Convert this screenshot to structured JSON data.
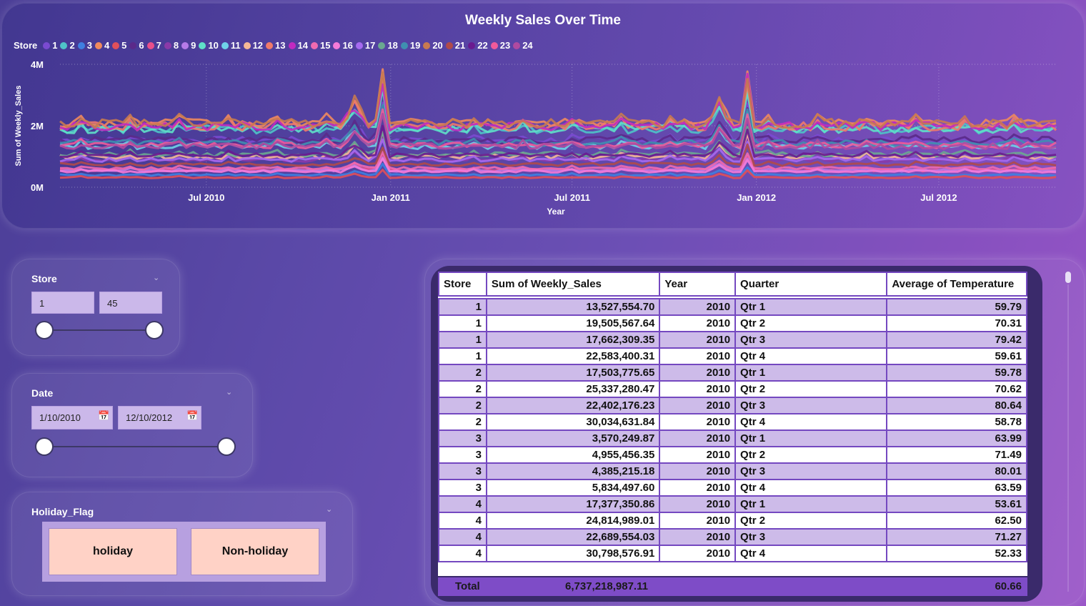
{
  "chart": {
    "title": "Weekly Sales Over Time",
    "legend_title": "Store",
    "legend": [
      {
        "label": "1",
        "color": "#7a4ad1"
      },
      {
        "label": "2",
        "color": "#4fc3c8"
      },
      {
        "label": "3",
        "color": "#3f7fe0"
      },
      {
        "label": "4",
        "color": "#f08a5d"
      },
      {
        "label": "5",
        "color": "#e0505a"
      },
      {
        "label": "6",
        "color": "#5a2a8a"
      },
      {
        "label": "7",
        "color": "#e84f8a"
      },
      {
        "label": "8",
        "color": "#8a3aa8"
      },
      {
        "label": "9",
        "color": "#b57ae8"
      },
      {
        "label": "10",
        "color": "#5fe0c8"
      },
      {
        "label": "11",
        "color": "#6fd3e8"
      },
      {
        "label": "12",
        "color": "#f5b896"
      },
      {
        "label": "13",
        "color": "#f07a6a"
      },
      {
        "label": "14",
        "color": "#c02ac0"
      },
      {
        "label": "15",
        "color": "#f06ab0"
      },
      {
        "label": "16",
        "color": "#f57ad8"
      },
      {
        "label": "17",
        "color": "#a66af0"
      },
      {
        "label": "18",
        "color": "#6aa890"
      },
      {
        "label": "19",
        "color": "#3f8fb0"
      },
      {
        "label": "20",
        "color": "#c87a50"
      },
      {
        "label": "21",
        "color": "#b04a4a"
      },
      {
        "label": "22",
        "color": "#6a1a90"
      },
      {
        "label": "23",
        "color": "#f05a9a"
      },
      {
        "label": "24",
        "color": "#b04aa0"
      }
    ]
  },
  "slicers": {
    "store": {
      "title": "Store",
      "min": "1",
      "max": "45"
    },
    "date": {
      "title": "Date",
      "start": "1/10/2010",
      "end": "12/10/2012"
    },
    "holiday": {
      "title": "Holiday_Flag",
      "options": [
        "holiday",
        "Non-holiday"
      ]
    }
  },
  "table": {
    "headers": [
      "Store",
      "Sum of Weekly_Sales",
      "Year",
      "Quarter",
      "Average of Temperature"
    ],
    "rows": [
      [
        "1",
        "13,527,554.70",
        "2010",
        "Qtr 1",
        "59.79"
      ],
      [
        "1",
        "19,505,567.64",
        "2010",
        "Qtr 2",
        "70.31"
      ],
      [
        "1",
        "17,662,309.35",
        "2010",
        "Qtr 3",
        "79.42"
      ],
      [
        "1",
        "22,583,400.31",
        "2010",
        "Qtr 4",
        "59.61"
      ],
      [
        "2",
        "17,503,775.65",
        "2010",
        "Qtr 1",
        "59.78"
      ],
      [
        "2",
        "25,337,280.47",
        "2010",
        "Qtr 2",
        "70.62"
      ],
      [
        "2",
        "22,402,176.23",
        "2010",
        "Qtr 3",
        "80.64"
      ],
      [
        "2",
        "30,034,631.84",
        "2010",
        "Qtr 4",
        "58.78"
      ],
      [
        "3",
        "3,570,249.87",
        "2010",
        "Qtr 1",
        "63.99"
      ],
      [
        "3",
        "4,955,456.35",
        "2010",
        "Qtr 2",
        "71.49"
      ],
      [
        "3",
        "4,385,215.18",
        "2010",
        "Qtr 3",
        "80.01"
      ],
      [
        "3",
        "5,834,497.60",
        "2010",
        "Qtr 4",
        "63.59"
      ],
      [
        "4",
        "17,377,350.86",
        "2010",
        "Qtr 1",
        "53.61"
      ],
      [
        "4",
        "24,814,989.01",
        "2010",
        "Qtr 2",
        "62.50"
      ],
      [
        "4",
        "22,689,554.03",
        "2010",
        "Qtr 3",
        "71.27"
      ],
      [
        "4",
        "30,798,576.91",
        "2010",
        "Qtr 4",
        "52.33"
      ]
    ],
    "total": {
      "label": "Total",
      "sales": "6,737,218,987.11",
      "temp": "60.66"
    }
  },
  "chart_data": {
    "type": "line",
    "title": "Weekly Sales Over Time",
    "xlabel": "Year",
    "ylabel": "Sum of Weekly_Sales",
    "x_range": [
      "2010-02-05",
      "2012-10-26"
    ],
    "x_ticks": [
      "Jul 2010",
      "Jan 2011",
      "Jul 2011",
      "Jan 2012",
      "Jul 2012"
    ],
    "y_ticks": [
      "0M",
      "2M",
      "4M"
    ],
    "ylim": [
      0,
      4000000
    ],
    "legend_position": "top-left",
    "series": [
      {
        "name": "1",
        "base": 1550000
      },
      {
        "name": "2",
        "base": 1900000
      },
      {
        "name": "3",
        "base": 400000
      },
      {
        "name": "4",
        "base": 2100000
      },
      {
        "name": "5",
        "base": 320000
      },
      {
        "name": "6",
        "base": 1550000
      },
      {
        "name": "7",
        "base": 560000
      },
      {
        "name": "8",
        "base": 900000
      },
      {
        "name": "9",
        "base": 550000
      },
      {
        "name": "10",
        "base": 1900000
      },
      {
        "name": "11",
        "base": 1350000
      },
      {
        "name": "12",
        "base": 1000000
      },
      {
        "name": "13",
        "base": 2000000
      },
      {
        "name": "14",
        "base": 2000000
      },
      {
        "name": "15",
        "base": 620000
      },
      {
        "name": "16",
        "base": 520000
      },
      {
        "name": "17",
        "base": 900000
      },
      {
        "name": "18",
        "base": 1080000
      },
      {
        "name": "19",
        "base": 1450000
      },
      {
        "name": "20",
        "base": 2100000
      },
      {
        "name": "21",
        "base": 750000
      },
      {
        "name": "22",
        "base": 1050000
      },
      {
        "name": "23",
        "base": 1380000
      },
      {
        "name": "24",
        "base": 1350000
      }
    ],
    "peaks": [
      {
        "date": "Nov 2010",
        "multiplier": 1.35
      },
      {
        "date": "Dec 2010",
        "multiplier": 1.8
      },
      {
        "date": "Nov 2011",
        "multiplier": 1.35
      },
      {
        "date": "Dec 2011",
        "multiplier": 1.75
      }
    ]
  }
}
